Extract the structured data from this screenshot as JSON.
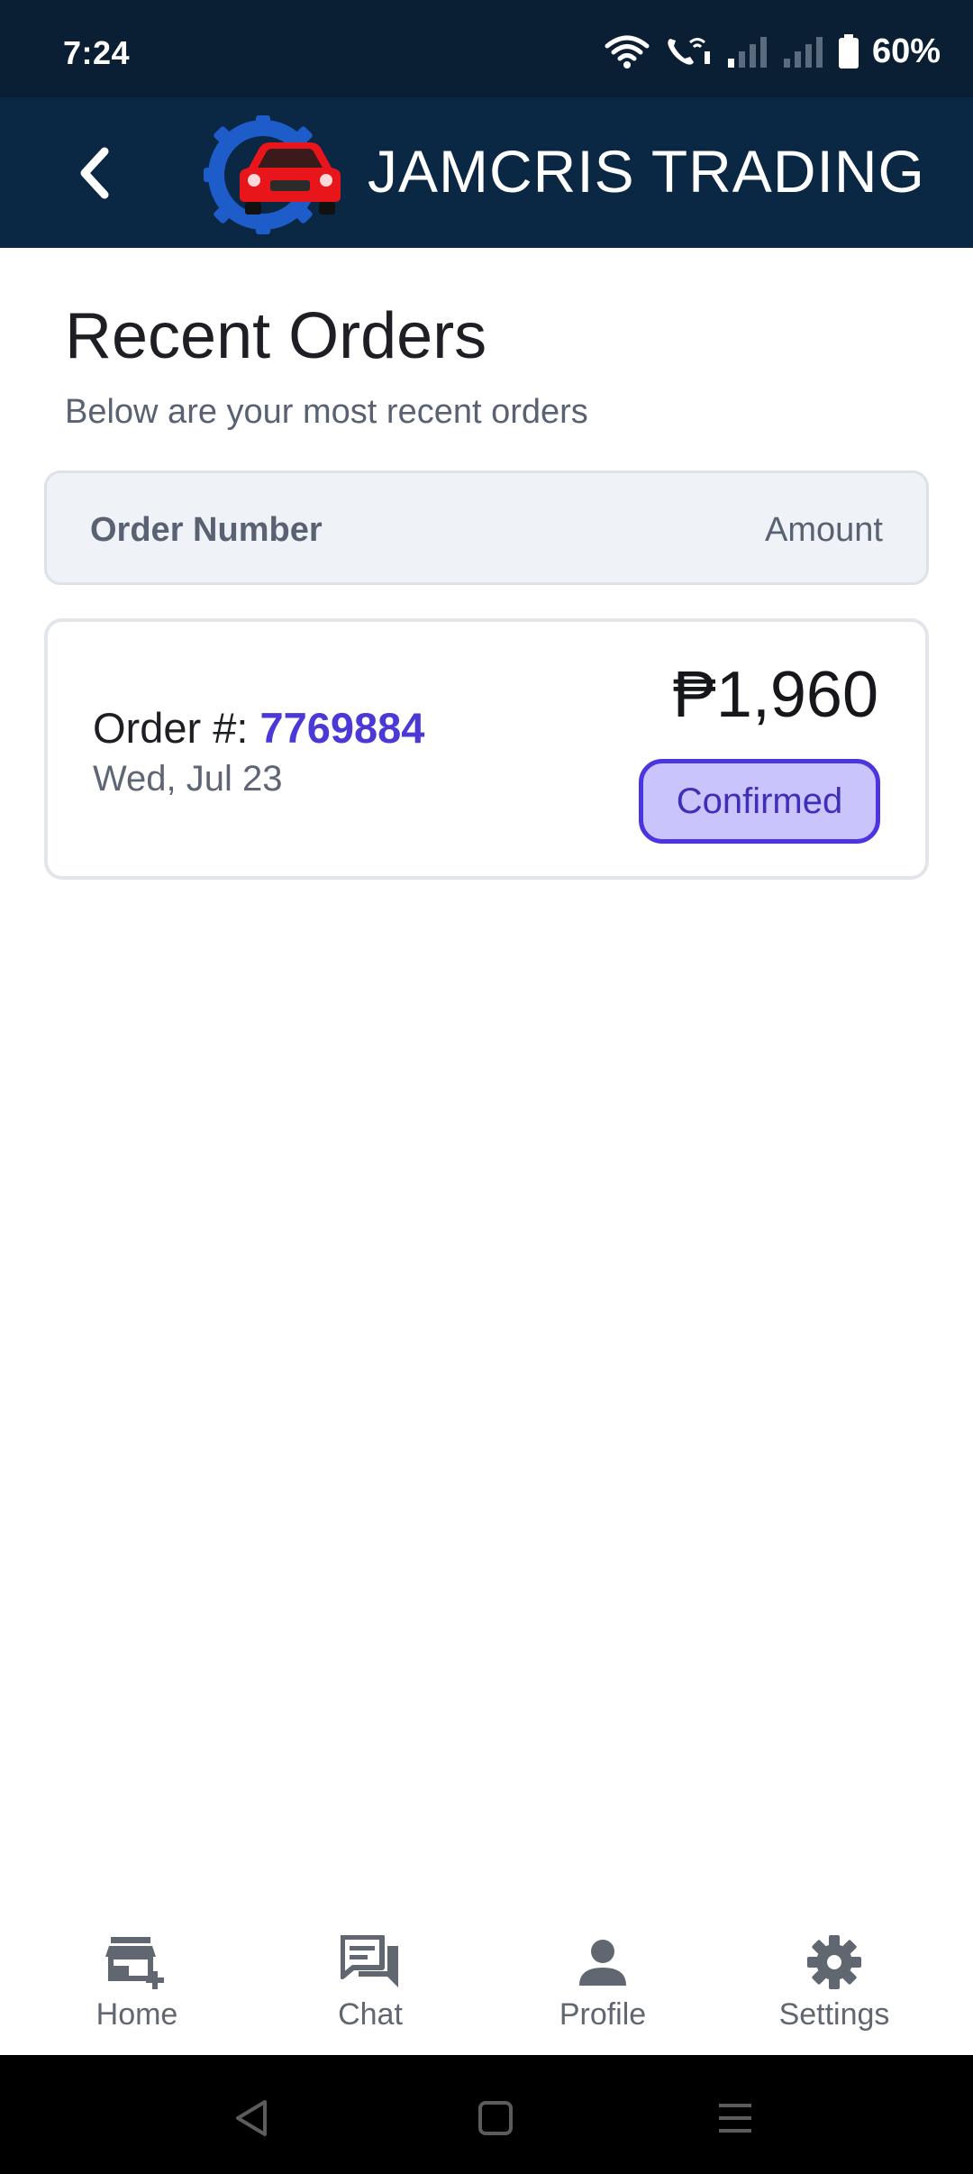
{
  "status_bar": {
    "time": "7:24",
    "battery": "60%"
  },
  "header": {
    "back_icon": "chevron-left-icon",
    "brand_name": "JAMCRIS TRADING",
    "logo_icon": "gear-car-logo",
    "background_color": "#0a2744"
  },
  "page": {
    "title": "Recent Orders",
    "subtitle": "Below are your most recent orders"
  },
  "orders_table": {
    "column_left": "Order Number",
    "column_right": "Amount",
    "orders": [
      {
        "order_label": "Order #: ",
        "order_number": "7769884",
        "date": "Wed, Jul 23",
        "amount": "₱1,960",
        "status": "Confirmed"
      }
    ]
  },
  "bottom_nav": {
    "items": [
      {
        "label": "Home",
        "icon": "store-add-icon"
      },
      {
        "label": "Chat",
        "icon": "chat-bubbles-icon"
      },
      {
        "label": "Profile",
        "icon": "person-icon"
      },
      {
        "label": "Settings",
        "icon": "gear-icon"
      }
    ]
  },
  "colors": {
    "accent": "#4a39d6",
    "status_pill_bg": "#c9c4fb",
    "status_pill_border": "#4b35e0"
  }
}
